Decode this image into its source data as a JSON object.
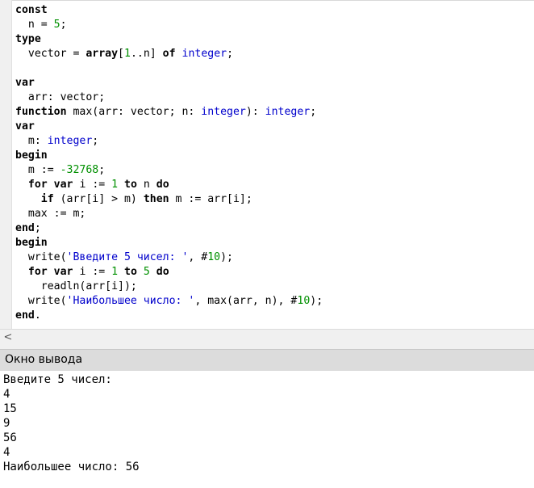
{
  "editor": {
    "lines": [
      {
        "parts": [
          {
            "t": "const",
            "c": "kw"
          }
        ]
      },
      {
        "parts": [
          {
            "t": "  n = ",
            "c": ""
          },
          {
            "t": "5",
            "c": "num"
          },
          {
            "t": ";",
            "c": ""
          }
        ]
      },
      {
        "parts": [
          {
            "t": "type",
            "c": "kw"
          }
        ]
      },
      {
        "parts": [
          {
            "t": "  vector = ",
            "c": ""
          },
          {
            "t": "array",
            "c": "kw"
          },
          {
            "t": "[",
            "c": ""
          },
          {
            "t": "1",
            "c": "num"
          },
          {
            "t": "..n] ",
            "c": ""
          },
          {
            "t": "of",
            "c": "kw"
          },
          {
            "t": " ",
            "c": ""
          },
          {
            "t": "integer",
            "c": "ty"
          },
          {
            "t": ";",
            "c": ""
          }
        ]
      },
      {
        "parts": [
          {
            "t": "",
            "c": ""
          }
        ]
      },
      {
        "parts": [
          {
            "t": "var",
            "c": "kw"
          }
        ]
      },
      {
        "parts": [
          {
            "t": "  arr: vector;",
            "c": ""
          }
        ]
      },
      {
        "parts": [
          {
            "t": "function",
            "c": "kw"
          },
          {
            "t": " max(arr: vector; n: ",
            "c": ""
          },
          {
            "t": "integer",
            "c": "ty"
          },
          {
            "t": "): ",
            "c": ""
          },
          {
            "t": "integer",
            "c": "ty"
          },
          {
            "t": ";",
            "c": ""
          }
        ]
      },
      {
        "parts": [
          {
            "t": "var",
            "c": "kw"
          }
        ]
      },
      {
        "parts": [
          {
            "t": "  m: ",
            "c": ""
          },
          {
            "t": "integer",
            "c": "ty"
          },
          {
            "t": ";",
            "c": ""
          }
        ]
      },
      {
        "parts": [
          {
            "t": "begin",
            "c": "kw"
          }
        ]
      },
      {
        "parts": [
          {
            "t": "  m := ",
            "c": ""
          },
          {
            "t": "-32768",
            "c": "num"
          },
          {
            "t": ";",
            "c": ""
          }
        ]
      },
      {
        "parts": [
          {
            "t": "  ",
            "c": ""
          },
          {
            "t": "for",
            "c": "kw"
          },
          {
            "t": " ",
            "c": ""
          },
          {
            "t": "var",
            "c": "kw"
          },
          {
            "t": " i := ",
            "c": ""
          },
          {
            "t": "1",
            "c": "num"
          },
          {
            "t": " ",
            "c": ""
          },
          {
            "t": "to",
            "c": "kw"
          },
          {
            "t": " n ",
            "c": ""
          },
          {
            "t": "do",
            "c": "kw"
          }
        ]
      },
      {
        "parts": [
          {
            "t": "    ",
            "c": ""
          },
          {
            "t": "if",
            "c": "kw"
          },
          {
            "t": " (arr[i] > m) ",
            "c": ""
          },
          {
            "t": "then",
            "c": "kw"
          },
          {
            "t": " m := arr[i];",
            "c": ""
          }
        ]
      },
      {
        "parts": [
          {
            "t": "  max := m;",
            "c": ""
          }
        ]
      },
      {
        "parts": [
          {
            "t": "end",
            "c": "kw"
          },
          {
            "t": ";",
            "c": ""
          }
        ]
      },
      {
        "parts": [
          {
            "t": "begin",
            "c": "kw"
          }
        ]
      },
      {
        "parts": [
          {
            "t": "  write(",
            "c": ""
          },
          {
            "t": "'Введите 5 чисел: '",
            "c": "str"
          },
          {
            "t": ", #",
            "c": ""
          },
          {
            "t": "10",
            "c": "num"
          },
          {
            "t": ");",
            "c": ""
          }
        ]
      },
      {
        "parts": [
          {
            "t": "  ",
            "c": ""
          },
          {
            "t": "for",
            "c": "kw"
          },
          {
            "t": " ",
            "c": ""
          },
          {
            "t": "var",
            "c": "kw"
          },
          {
            "t": " i := ",
            "c": ""
          },
          {
            "t": "1",
            "c": "num"
          },
          {
            "t": " ",
            "c": ""
          },
          {
            "t": "to",
            "c": "kw"
          },
          {
            "t": " ",
            "c": ""
          },
          {
            "t": "5",
            "c": "num"
          },
          {
            "t": " ",
            "c": ""
          },
          {
            "t": "do",
            "c": "kw"
          }
        ]
      },
      {
        "parts": [
          {
            "t": "    readln(arr[i]);",
            "c": ""
          }
        ]
      },
      {
        "parts": [
          {
            "t": "  write(",
            "c": ""
          },
          {
            "t": "'Наибольшее число: '",
            "c": "str"
          },
          {
            "t": ", max(arr, n), #",
            "c": ""
          },
          {
            "t": "10",
            "c": "num"
          },
          {
            "t": ");",
            "c": ""
          }
        ]
      },
      {
        "parts": [
          {
            "t": "end",
            "c": "kw"
          },
          {
            "t": ".",
            "c": ""
          }
        ]
      }
    ]
  },
  "scrollbar": {
    "left_arrow": "<",
    "left_arrow_icon": "chevron-left-icon"
  },
  "output_panel": {
    "title": "Окно вывода",
    "lines": [
      "Введите 5 чисел:",
      "4",
      "15",
      "9",
      "56",
      "4",
      "Наибольшее число: 56"
    ]
  },
  "colors": {
    "keyword_type": "#0000cc",
    "number": "#009000",
    "string": "#0000cc",
    "panel_header_bg": "#dcdcdc"
  }
}
